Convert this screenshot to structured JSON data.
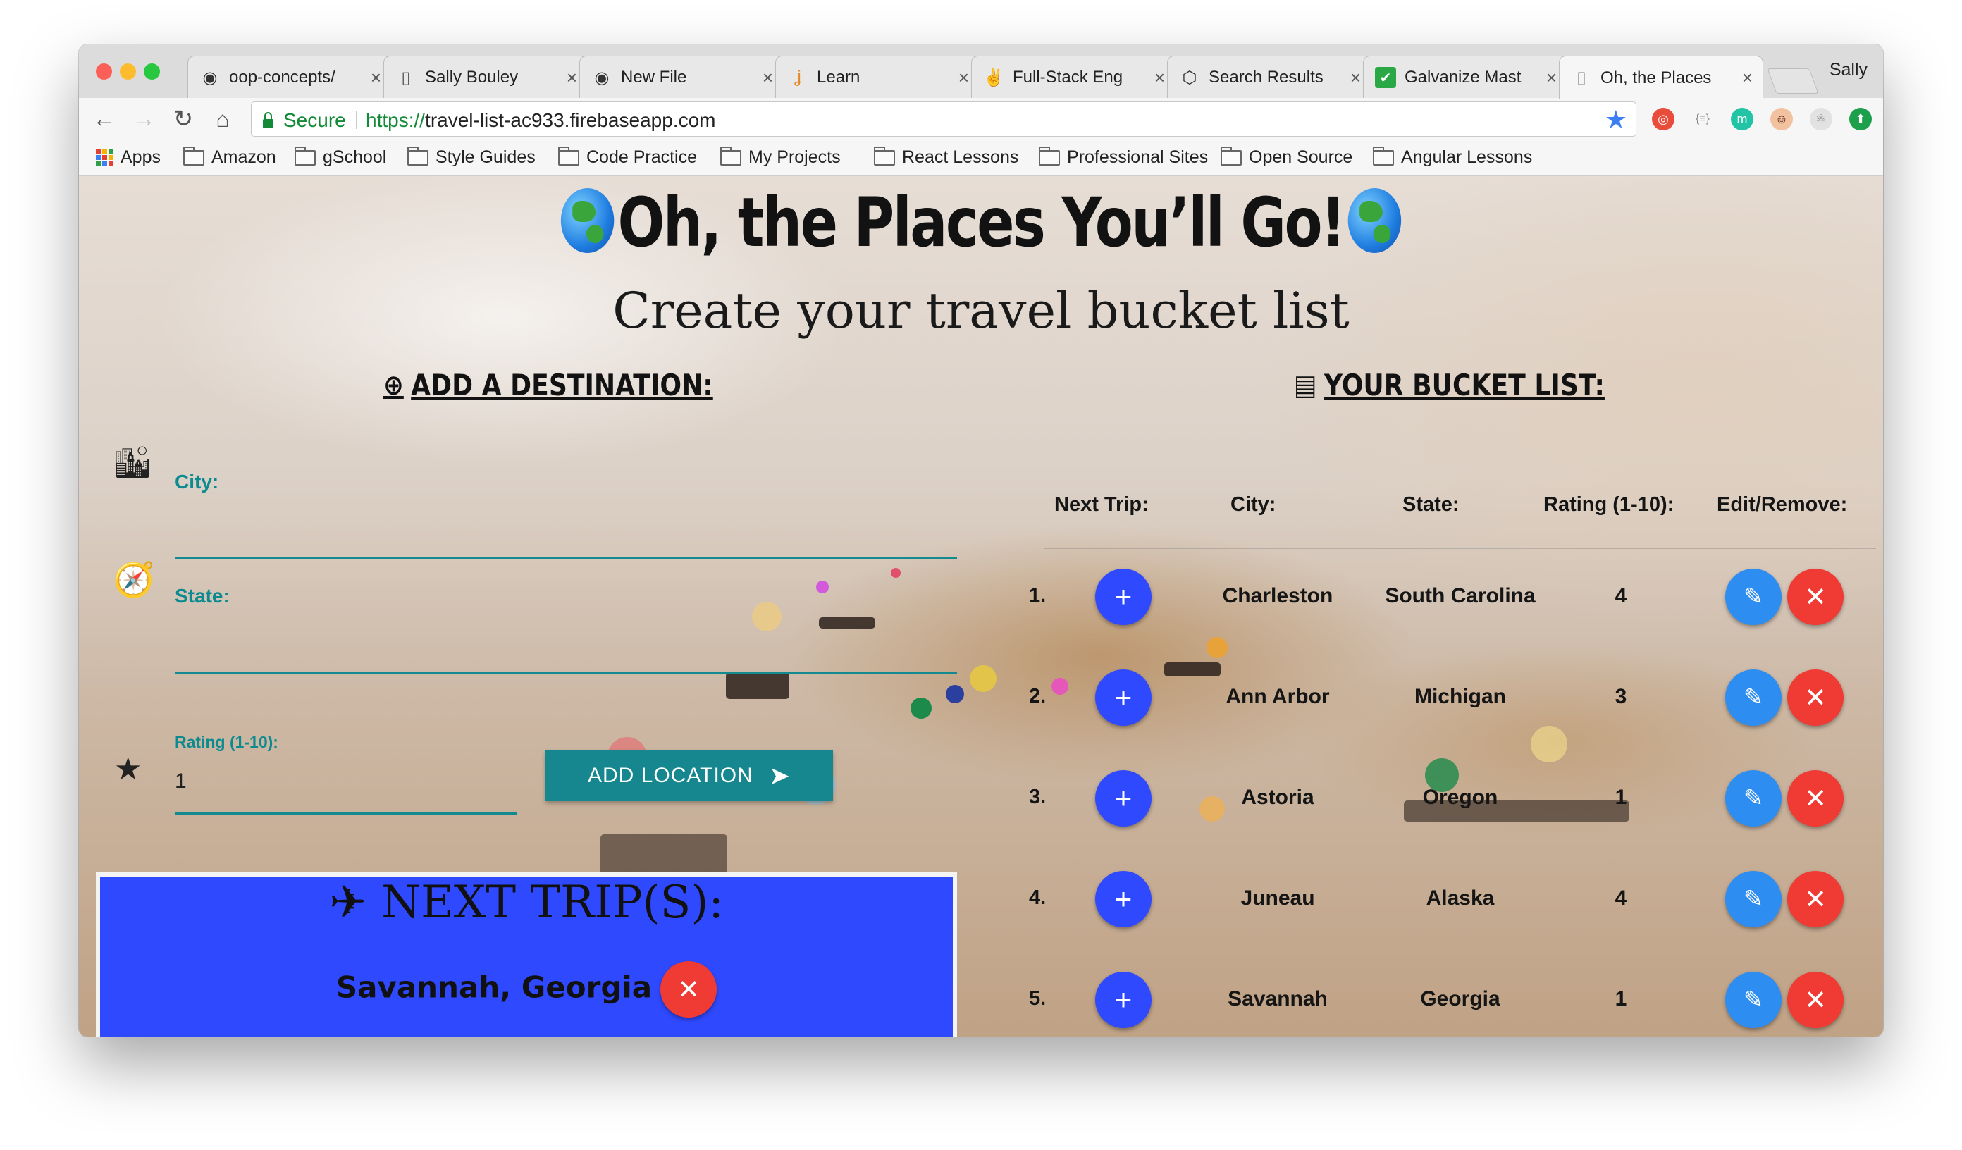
{
  "browser": {
    "tabs": [
      {
        "icon": "github-icon",
        "glyph": "◉",
        "label": "oop-concepts/"
      },
      {
        "icon": "document-icon",
        "glyph": "▯",
        "label": "Sally Bouley"
      },
      {
        "icon": "github-icon",
        "glyph": "◉",
        "label": "New File"
      },
      {
        "icon": "learn-icon",
        "glyph": "ʝ",
        "label": "Learn"
      },
      {
        "icon": "peace-hand-icon",
        "glyph": "✌",
        "label": "Full-Stack Eng"
      },
      {
        "icon": "codepen-icon",
        "glyph": "⬡",
        "label": "Search Results"
      },
      {
        "icon": "checkbox-icon",
        "glyph": "✔",
        "label": "Galvanize Mast"
      },
      {
        "icon": "document-icon",
        "glyph": "▯",
        "label": "Oh, the Places"
      }
    ],
    "close_glyph": "×",
    "profile": "Sally",
    "secure_label": "Secure",
    "url_scheme": "https://",
    "url_host": "travel-list-ac933.firebaseapp.com",
    "bookmarks": [
      "Apps",
      "Amazon",
      "gSchool",
      "Style Guides",
      "Code Practice",
      "My Projects",
      "React Lessons",
      "Professional Sites",
      "Open Source",
      "Angular Lessons"
    ],
    "colors": {
      "secure": "#138a36",
      "star": "#3b7ff2"
    }
  },
  "page": {
    "title": "Oh, the Places You’ll Go!",
    "subtitle": "Create your travel bucket list",
    "add_heading": "ADD A DESTINATION:",
    "list_heading": "YOUR BUCKET LIST:",
    "form": {
      "city_label": "City:",
      "state_label": "State:",
      "rating_label": "Rating (1-10):",
      "rating_value": "1",
      "add_button": "ADD LOCATION"
    },
    "next_trips": {
      "title": "NEXT TRIP(S):",
      "items": [
        "Savannah, Georgia"
      ]
    },
    "table": {
      "headers": [
        "Next Trip:",
        "City:",
        "State:",
        "Rating (1-10):",
        "Edit/Remove:"
      ],
      "rows": [
        {
          "num": "1.",
          "city": "Charleston",
          "state": "South Carolina",
          "rating": "4"
        },
        {
          "num": "2.",
          "city": "Ann Arbor",
          "state": "Michigan",
          "rating": "3"
        },
        {
          "num": "3.",
          "city": "Astoria",
          "state": "Oregon",
          "rating": "1"
        },
        {
          "num": "4.",
          "city": "Juneau",
          "state": "Alaska",
          "rating": "4"
        },
        {
          "num": "5.",
          "city": "Savannah",
          "state": "Georgia",
          "rating": "1"
        }
      ]
    },
    "colors": {
      "teal": "#16878e",
      "blue_button": "#2f49ff",
      "edit_button": "#2e8df0",
      "delete_button": "#f03a34",
      "card": "#2f49ff"
    }
  }
}
